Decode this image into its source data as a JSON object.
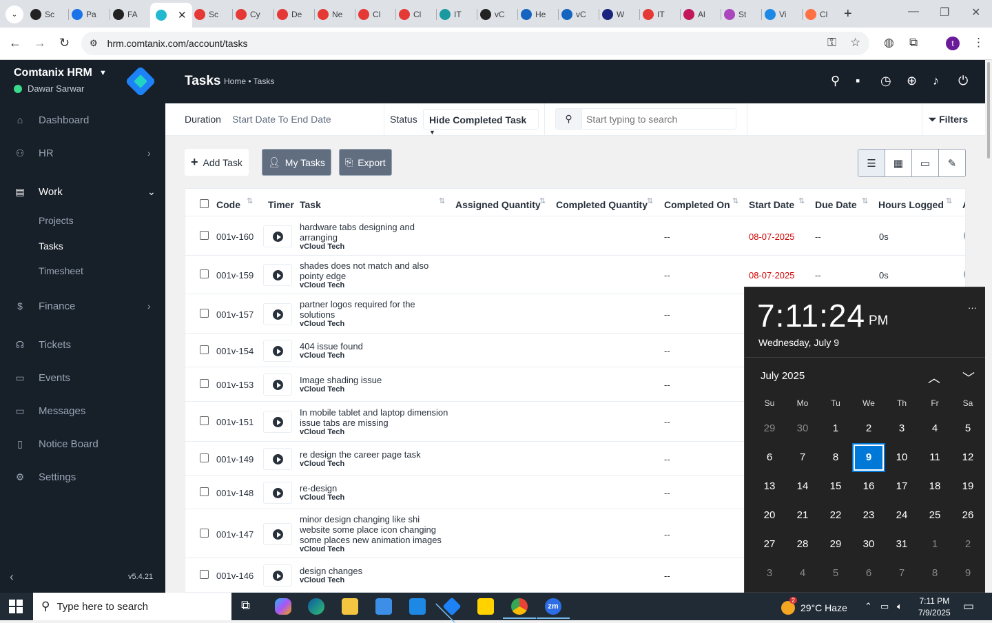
{
  "browser": {
    "tabs": [
      {
        "label": "Sc",
        "color": "#222222"
      },
      {
        "label": "Pa",
        "color": "#1a73e8"
      },
      {
        "label": "FA",
        "color": "#222222"
      },
      {
        "label": "",
        "color": "#22b8cf",
        "active": true
      },
      {
        "label": "Sc",
        "color": "#e53935"
      },
      {
        "label": "Cy",
        "color": "#e53935"
      },
      {
        "label": "De",
        "color": "#e53935"
      },
      {
        "label": "Ne",
        "color": "#e53935"
      },
      {
        "label": "Cl",
        "color": "#e53935"
      },
      {
        "label": "Cl",
        "color": "#e53935"
      },
      {
        "label": "IT",
        "color": "#1a9aa0"
      },
      {
        "label": "vC",
        "color": "#222222"
      },
      {
        "label": "He",
        "color": "#1565c0"
      },
      {
        "label": "vC",
        "color": "#1565c0"
      },
      {
        "label": "W",
        "color": "#1a237e"
      },
      {
        "label": "IT",
        "color": "#e53935"
      },
      {
        "label": "Al",
        "color": "#c2185b"
      },
      {
        "label": "St",
        "color": "#ab47bc"
      },
      {
        "label": "Vi",
        "color": "#1e88e5"
      },
      {
        "label": "Cl",
        "color": "#ff7043"
      }
    ],
    "url": "hrm.comtanix.com/account/tasks",
    "profile_initial": "t"
  },
  "sidebar": {
    "brand": "Comtanix HRM",
    "user": "Dawar Sarwar",
    "nav": [
      {
        "label": "Dashboard",
        "icon": "home-icon",
        "glyph": "⌂"
      },
      {
        "label": "HR",
        "icon": "users-icon",
        "glyph": "⚇"
      },
      {
        "label": "Work",
        "icon": "briefcase-icon",
        "glyph": "▤"
      },
      {
        "label": "Finance",
        "icon": "dollar-icon",
        "glyph": "$"
      },
      {
        "label": "Tickets",
        "icon": "headset-icon",
        "glyph": "☊"
      },
      {
        "label": "Events",
        "icon": "calendar-icon",
        "glyph": "▭"
      },
      {
        "label": "Messages",
        "icon": "message-icon",
        "glyph": "▭"
      },
      {
        "label": "Notice Board",
        "icon": "clipboard-icon",
        "glyph": "▯"
      },
      {
        "label": "Settings",
        "icon": "gear-icon",
        "glyph": "⚙"
      }
    ],
    "work_sub": [
      "Projects",
      "Tasks",
      "Timesheet"
    ],
    "version": "v5.4.21"
  },
  "header": {
    "title": "Tasks",
    "breadcrumb": "Home • Tasks"
  },
  "filters": {
    "duration_label": "Duration",
    "duration_value": "Start Date To End Date",
    "status_label": "Status",
    "status_value": "Hide Completed Task",
    "search_placeholder": "Start typing to search",
    "filters_label": "Filters"
  },
  "actions": {
    "add_task": "Add Task",
    "my_tasks": "My Tasks",
    "export": "Export"
  },
  "table": {
    "headers": {
      "code": "Code",
      "timer": "Timer",
      "task": "Task",
      "assigned": "Assigned Quantity",
      "completed_qty": "Completed Quantity",
      "completed_on": "Completed On",
      "start": "Start Date",
      "due": "Due Date",
      "hours": "Hours Logged",
      "assignee": "A"
    },
    "rows": [
      {
        "code": "001v-160",
        "task": "hardware tabs designing and arranging",
        "project": "vCloud Tech",
        "completed_on": "--",
        "start": "08-07-2025",
        "due": "--",
        "hours": "0s"
      },
      {
        "code": "001v-159",
        "task": "shades does not match and also pointy edge",
        "project": "vCloud Tech",
        "completed_on": "--",
        "start": "08-07-2025",
        "due": "--",
        "hours": "0s"
      },
      {
        "code": "001v-157",
        "task": "partner logos required for the solutions",
        "project": "vCloud Tech",
        "completed_on": "--"
      },
      {
        "code": "001v-154",
        "task": "404 issue found",
        "project": "vCloud Tech",
        "completed_on": "--"
      },
      {
        "code": "001v-153",
        "task": "Image shading issue",
        "project": "vCloud Tech",
        "completed_on": "--"
      },
      {
        "code": "001v-151",
        "task": "In mobile tablet and laptop dimension issue tabs are missing",
        "project": "vCloud Tech",
        "completed_on": "--"
      },
      {
        "code": "001v-149",
        "task": "re design the career page task",
        "project": "vCloud Tech",
        "completed_on": "--"
      },
      {
        "code": "001v-148",
        "task": "re-design",
        "project": "vCloud Tech",
        "completed_on": "--"
      },
      {
        "code": "001v-147",
        "task": "minor design changing like shi website some place icon changing some places new animation images",
        "project": "vCloud Tech",
        "completed_on": "--"
      },
      {
        "code": "001v-146",
        "task": "design changes",
        "project": "vCloud Tech",
        "completed_on": "--"
      }
    ]
  },
  "clock": {
    "time": "7:11:24",
    "ampm": "PM",
    "date": "Wednesday, July 9",
    "month": "July 2025",
    "weekdays": [
      "Su",
      "Mo",
      "Tu",
      "We",
      "Th",
      "Fr",
      "Sa"
    ],
    "days": [
      [
        "29",
        "30",
        "1",
        "2",
        "3",
        "4",
        "5"
      ],
      [
        "6",
        "7",
        "8",
        "9",
        "10",
        "11",
        "12"
      ],
      [
        "13",
        "14",
        "15",
        "16",
        "17",
        "18",
        "19"
      ],
      [
        "20",
        "21",
        "22",
        "23",
        "24",
        "25",
        "26"
      ],
      [
        "27",
        "28",
        "29",
        "30",
        "31",
        "1",
        "2"
      ],
      [
        "3",
        "4",
        "5",
        "6",
        "7",
        "8",
        "9"
      ]
    ],
    "today": "9"
  },
  "taskbar": {
    "search_placeholder": "Type here to search",
    "weather": "29°C  Haze",
    "weather_badge": "2",
    "time": "7:11 PM",
    "date": "7/9/2025"
  }
}
